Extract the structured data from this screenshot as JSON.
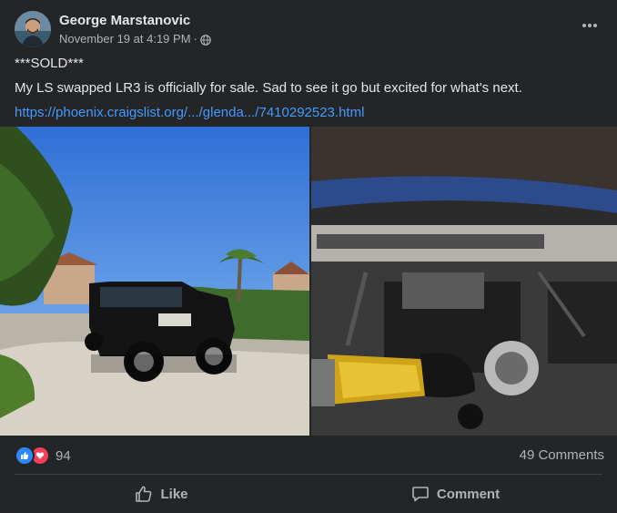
{
  "post": {
    "author": "George Marstanovic",
    "timestamp": "November 19 at 4:19 PM",
    "separator": "·",
    "audience_icon": "globe-icon",
    "status": "***SOLD***",
    "body": "My LS swapped LR3 is officially for sale. Sad to see it go but excited for what's next.",
    "link_text": "https://phoenix.craigslist.org/.../glenda.../7410292523.html"
  },
  "photos": [
    {
      "subject": "black Land Rover LR3 parked in driveway"
    },
    {
      "subject": "LS engine in LR3 engine bay"
    }
  ],
  "engagement": {
    "reaction_icons": [
      "like-icon",
      "love-icon"
    ],
    "reaction_count": "94",
    "comments": "49 Comments"
  },
  "actions": {
    "like_label": "Like",
    "comment_label": "Comment"
  },
  "colors": {
    "background": "#242526",
    "text": "#e4e6eb",
    "secondary_text": "#b0b3b8",
    "link": "#4599ff",
    "like_blue": "#2d88ff",
    "love_red": "#f33e58"
  }
}
